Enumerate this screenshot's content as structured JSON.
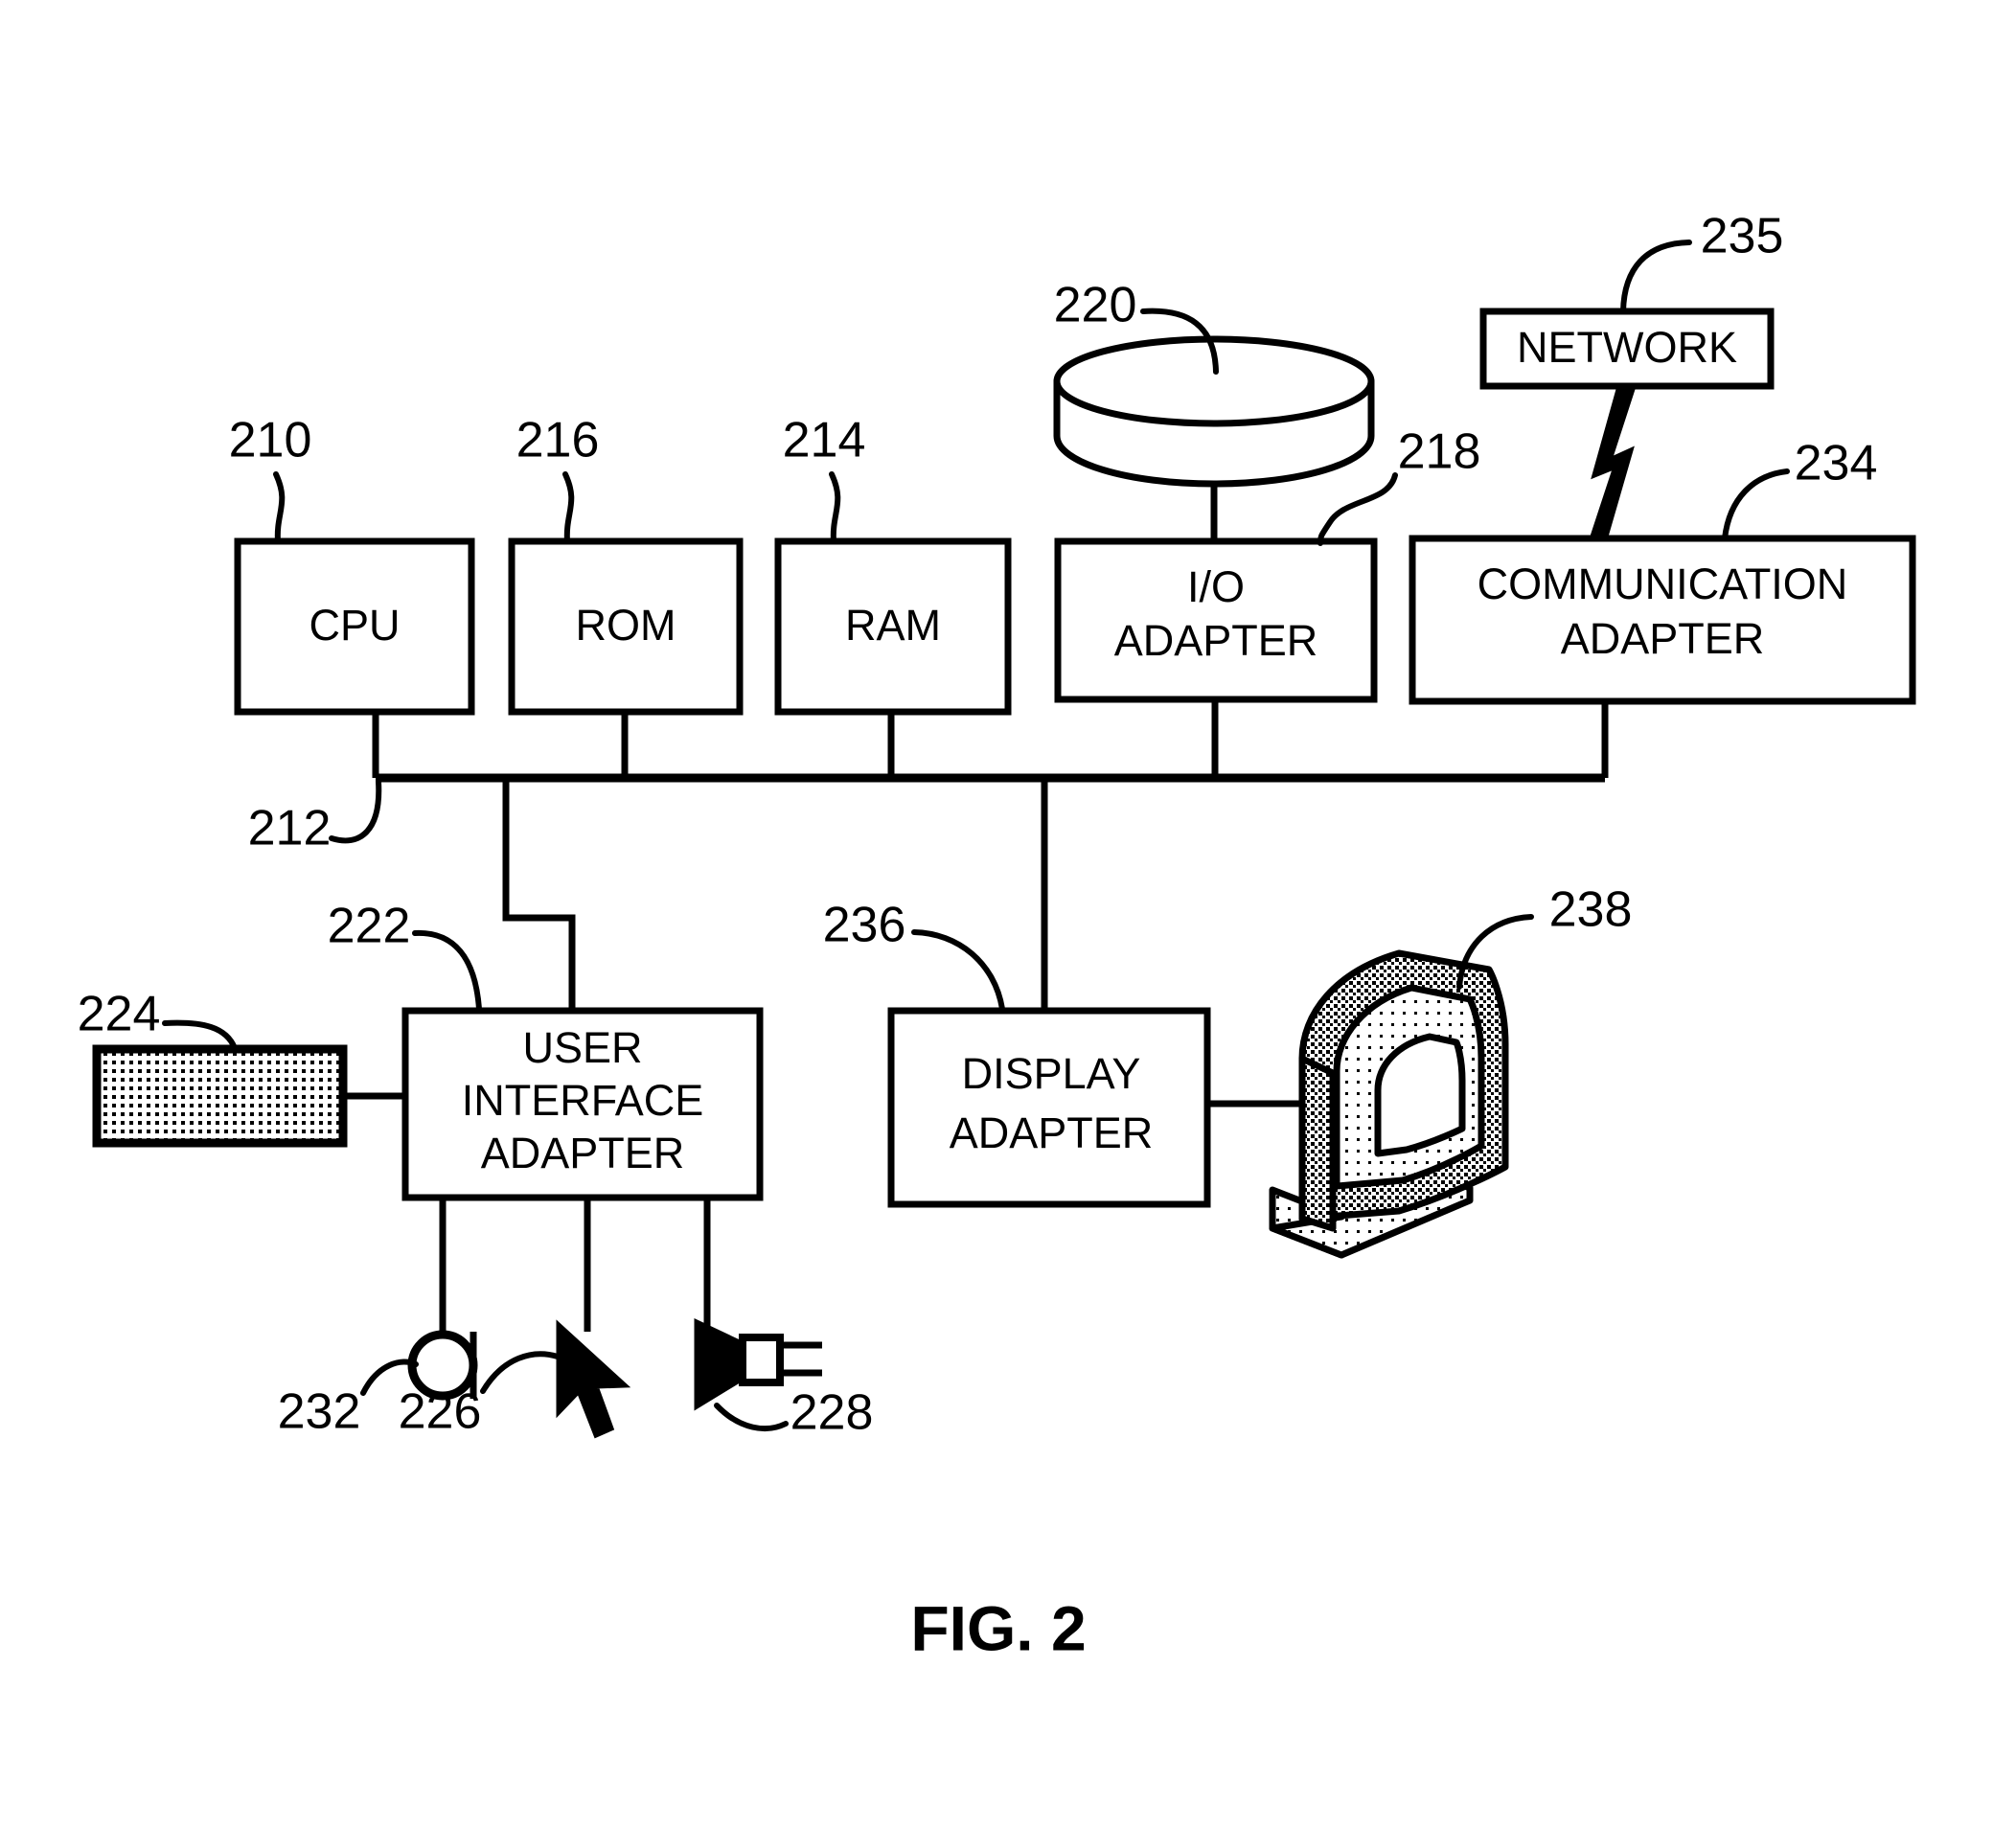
{
  "figure": {
    "caption": "FIG. 2",
    "title": "Computer system block diagram"
  },
  "blocks": [
    {
      "id": "cpu",
      "label": "CPU",
      "ref": "210"
    },
    {
      "id": "rom",
      "label": "ROM",
      "ref": "216"
    },
    {
      "id": "ram",
      "label": "RAM",
      "ref": "214"
    },
    {
      "id": "io",
      "label_line1": "I/O",
      "label_line2": "ADAPTER",
      "ref": "218"
    },
    {
      "id": "comm",
      "label_line1": "COMMUNICATION",
      "label_line2": "ADAPTER",
      "ref": "234"
    },
    {
      "id": "network",
      "label": "NETWORK",
      "ref": "235"
    },
    {
      "id": "uia",
      "label_line1": "USER",
      "label_line2": "INTERFACE",
      "label_line3": "ADAPTER",
      "ref": "222"
    },
    {
      "id": "display",
      "label_line1": "DISPLAY",
      "label_line2": "ADAPTER",
      "ref": "236"
    }
  ],
  "peripherals": [
    {
      "id": "disk",
      "name": "disk-storage",
      "ref": "220"
    },
    {
      "id": "keyboard",
      "name": "keyboard",
      "ref": "224"
    },
    {
      "id": "microphone",
      "name": "microphone",
      "ref": "232"
    },
    {
      "id": "mouse",
      "name": "mouse-pointer",
      "ref": "226"
    },
    {
      "id": "speaker",
      "name": "speaker",
      "ref": "228"
    },
    {
      "id": "monitor",
      "name": "display-monitor",
      "ref": "238"
    }
  ],
  "bus": {
    "ref": "212",
    "name": "system-bus"
  },
  "refs": {
    "r210": "210",
    "r212": "212",
    "r214": "214",
    "r216": "216",
    "r218": "218",
    "r220": "220",
    "r222": "222",
    "r224": "224",
    "r226": "226",
    "r228": "228",
    "r232": "232",
    "r234": "234",
    "r235": "235",
    "r236": "236",
    "r238": "238"
  },
  "labels": {
    "cpu": "CPU",
    "rom": "ROM",
    "ram": "RAM",
    "io_1": "I/O",
    "io_2": "ADAPTER",
    "comm_1": "COMMUNICATION",
    "comm_2": "ADAPTER",
    "network": "NETWORK",
    "uia_1": "USER",
    "uia_2": "INTERFACE",
    "uia_3": "ADAPTER",
    "disp_1": "DISPLAY",
    "disp_2": "ADAPTER",
    "fig": "FIG. 2"
  },
  "colors": {
    "ink": "#000000",
    "paper": "#ffffff",
    "halftone": "#000000"
  }
}
